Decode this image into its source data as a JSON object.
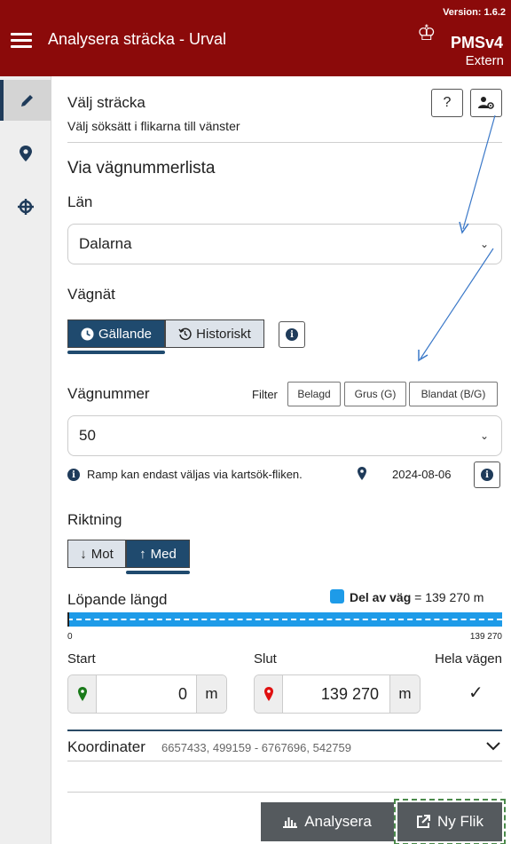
{
  "header": {
    "title": "Analysera sträcka - Urval",
    "version": "Version: 1.6.2",
    "brand": "PMSv4",
    "brand_sub": "Extern"
  },
  "sidebar": {
    "items": [
      {
        "icon": "pencil-icon",
        "active": true
      },
      {
        "icon": "map-marker-icon",
        "active": false
      },
      {
        "icon": "crosshair-icon",
        "active": false
      }
    ]
  },
  "main": {
    "heading": "Välj sträcka",
    "subheading": "Välj söksätt i flikarna till vänster",
    "help_label": "?",
    "section_title": "Via vägnummerlista",
    "lan_label": "Län",
    "lan_value": "Dalarna",
    "vagnat_label": "Vägnät",
    "vagnat_options": [
      "Gällande",
      "Historiskt"
    ],
    "vagnummer_label": "Vägnummer",
    "filter_label": "Filter",
    "filters": [
      "Belagd",
      "Grus (G)",
      "Blandat (B/G)"
    ],
    "vagnummer_value": "50",
    "ramp_note": "Ramp kan endast väljas via kartsök-fliken.",
    "date": "2024-08-06",
    "riktning_label": "Riktning",
    "riktning_options": [
      "Mot",
      "Med"
    ],
    "lopande_label": "Löpande längd",
    "del_av_vag_label": "Del av väg",
    "del_av_vag_value": "= 139 270 m",
    "bar_start": "0",
    "bar_end": "139 270",
    "start_label": "Start",
    "slut_label": "Slut",
    "hela_label": "Hela vägen",
    "start_value": "0",
    "slut_value": "139 270",
    "unit": "m",
    "hela_check": "✓",
    "koordinater_label": "Koordinater",
    "koordinater_value": "6657433, 499159 - 6767696, 542759",
    "analysera_label": "Analysera",
    "nyflik_label": "Ny Flik"
  },
  "colors": {
    "header": "#8b0a0a",
    "active": "#1f4a6e",
    "bar": "#1e9be8",
    "start_pin": "#1a7a1a",
    "end_pin": "#e01010"
  }
}
